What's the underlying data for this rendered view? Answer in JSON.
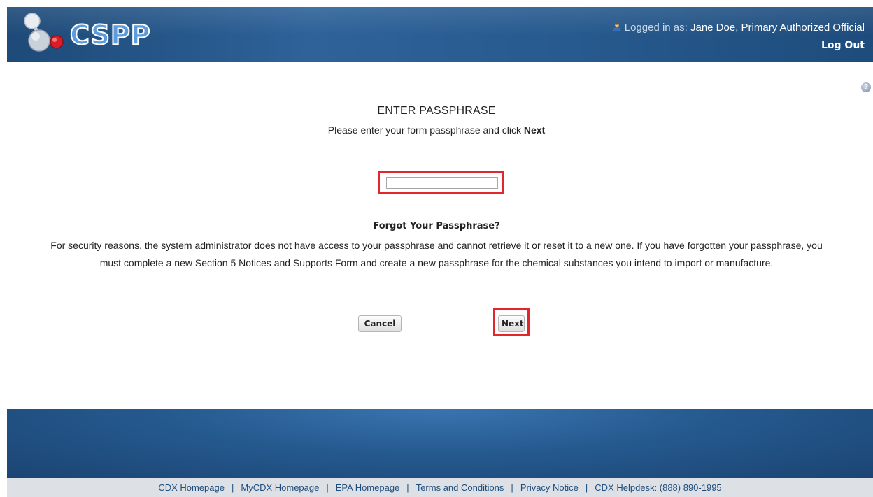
{
  "header": {
    "logo_text": "CSPP",
    "logged_in_prefix": "Logged in as:",
    "user": "Jane Doe, Primary Authorized Official",
    "logout": "Log Out"
  },
  "main": {
    "title": "ENTER PASSPHRASE",
    "instruction_prefix": "Please enter your form passphrase and click",
    "instruction_bold": "Next",
    "passphrase_value": "",
    "forgot_heading": "Forgot Your Passphrase?",
    "forgot_text": "For security reasons, the system administrator does not have access to your passphrase and cannot retrieve it or reset it to a new one. If you have forgotten your passphrase, you must complete a new Section 5 Notices and Supports Form and create a new passphrase for the chemical substances you intend to import or manufacture.",
    "cancel_label": "Cancel",
    "next_label": "Next"
  },
  "footer": {
    "links": [
      "CDX Homepage",
      "MyCDX Homepage",
      "EPA Homepage",
      "Terms and Conditions",
      "Privacy Notice",
      "CDX Helpdesk: (888) 890-1995"
    ]
  },
  "colors": {
    "header_blue": "#2e6299",
    "highlight_red": "#e3262b",
    "footer_bg": "#dde1e6"
  }
}
